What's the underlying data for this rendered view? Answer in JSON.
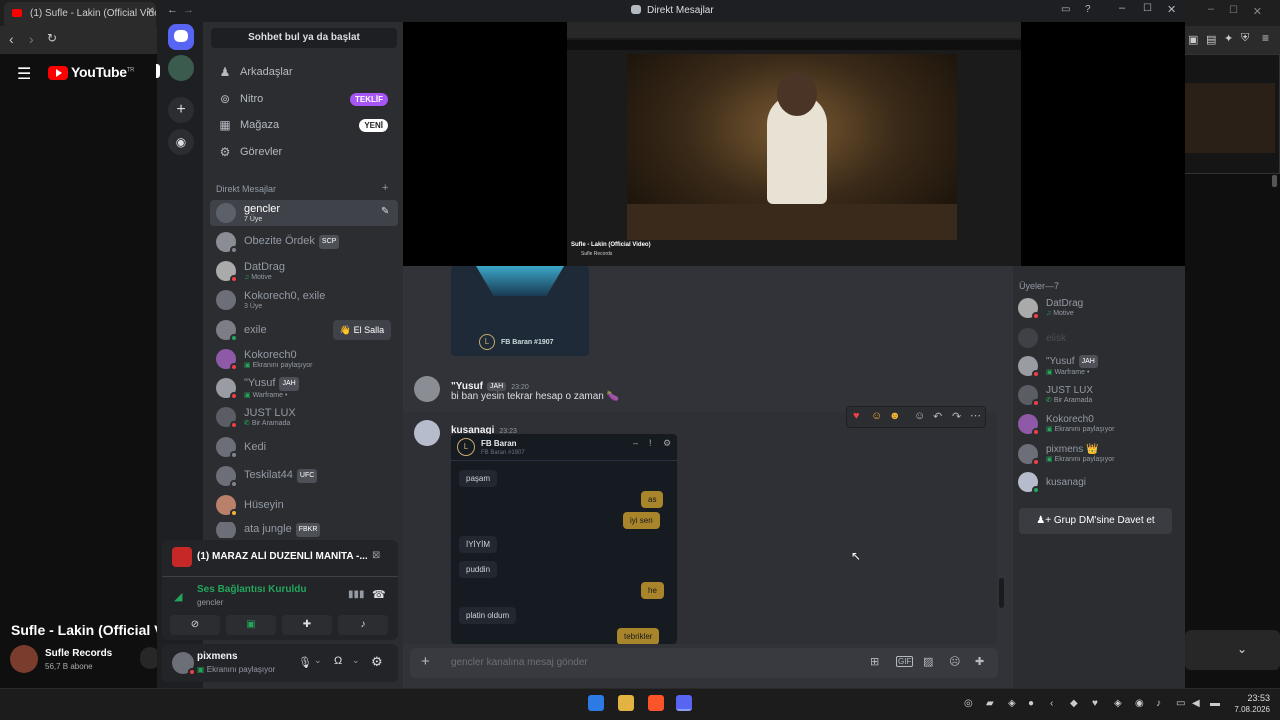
{
  "browser": {
    "tab_title": "(1) Sufle - Lakin (Official Vide",
    "youtube_logo": "YouTube",
    "youtube_region": "TR",
    "video_title": "Sufle - Lakin (Official Video)",
    "channel_name": "Sufle Records",
    "channel_subs": "56,7 B abone"
  },
  "window": {
    "title": "Direkt Mesajlar",
    "back_icon": "back-arrow-icon",
    "forward_icon": "forward-arrow-icon"
  },
  "search": {
    "placeholder": "Sohbet bul ya da başlat"
  },
  "nav": [
    {
      "label": "Arkadaşlar",
      "icon": "friends-icon",
      "badge": ""
    },
    {
      "label": "Nitro",
      "icon": "nitro-icon",
      "badge": "TEKLİF"
    },
    {
      "label": "Mağaza",
      "icon": "shop-icon",
      "badge": "YENİ"
    },
    {
      "label": "Görevler",
      "icon": "quests-icon",
      "badge": ""
    }
  ],
  "dm_header": "Direkt Mesajlar",
  "dms": [
    {
      "name": "gencler",
      "sub": "7 Üye",
      "tag": "",
      "active": true,
      "status": "group"
    },
    {
      "name": "Obezite Ördek",
      "sub": "",
      "tag": "SCP",
      "status": "offline"
    },
    {
      "name": "DatDrag",
      "sub": "Motive",
      "tag": "",
      "status": "dnd"
    },
    {
      "name": "Kokorech0, exile",
      "sub": "3 Üye",
      "tag": "",
      "status": "group"
    },
    {
      "name": "exile",
      "sub": "",
      "tag": "",
      "status": "online",
      "wave": "El Salla"
    },
    {
      "name": "Kokorech0",
      "sub": "Ekranını paylaşıyor",
      "tag": "",
      "status": "dnd"
    },
    {
      "name": "\"Yusuf",
      "sub": "Warframe •",
      "tag": "JAH",
      "status": "dnd"
    },
    {
      "name": "JUST LUX",
      "sub": "Bir Aramada",
      "tag": "",
      "status": "dnd"
    },
    {
      "name": "Kedi",
      "sub": "",
      "tag": "",
      "status": "offline"
    },
    {
      "name": "Teskilat44",
      "sub": "",
      "tag": "UFC",
      "status": "offline"
    },
    {
      "name": "Hüseyin",
      "sub": "",
      "tag": "",
      "status": "idle"
    },
    {
      "name": "ata jungle",
      "sub": "",
      "tag": "FBKR",
      "status": "offline"
    }
  ],
  "voice": {
    "stream_title": "(1) MARAZ ALİ DÜZENLİ MANİTA -...",
    "connection": "Ses Bağlantısı Kuruldu",
    "channel": "gencler"
  },
  "user": {
    "name": "pixmens",
    "status": "Ekranını paylaşıyor"
  },
  "stream_preview": {
    "video_title": "Sufle - Lakin (Official Video)",
    "channel": "Sufle Records"
  },
  "messages": {
    "embed_name": "FB Baran #1907",
    "msg1": {
      "author": "\"Yusuf",
      "tag": "JAH",
      "time": "23:20",
      "text": "bi ban yesin tekrar hesap o zaman 🍆"
    },
    "msg2": {
      "author": "kusanagi",
      "time": "23:23"
    },
    "screenshot": {
      "header": "FB Baran",
      "subheader": "FB Baran #1907",
      "bubbles": [
        {
          "side": "left",
          "text": "paşam"
        },
        {
          "side": "right",
          "text": "as"
        },
        {
          "side": "right",
          "text": "iyi sen"
        },
        {
          "side": "left",
          "text": "İYİYİM"
        },
        {
          "side": "left",
          "text": "puddin"
        },
        {
          "side": "right",
          "text": "he"
        },
        {
          "side": "left",
          "text": "platin oldum"
        },
        {
          "side": "right",
          "text": "tebrikler"
        }
      ]
    }
  },
  "composer": {
    "placeholder": "gencler kanalına mesaj gönder"
  },
  "members_header": "Üyeler—7",
  "members": [
    {
      "name": "DatDrag",
      "sub": "Motive",
      "tag": "",
      "status": "dnd"
    },
    {
      "name": "eiisk",
      "sub": "",
      "tag": "",
      "status": "offline",
      "dim": true
    },
    {
      "name": "\"Yusuf",
      "sub": "Warframe •",
      "tag": "JAH",
      "status": "dnd"
    },
    {
      "name": "JUST LUX",
      "sub": "Bir Aramada",
      "tag": "",
      "status": "dnd"
    },
    {
      "name": "Kokorech0",
      "sub": "Ekranını paylaşıyor",
      "tag": "",
      "status": "dnd"
    },
    {
      "name": "pixmens 👑",
      "sub": "Ekranını paylaşıyor",
      "tag": "",
      "status": "dnd"
    },
    {
      "name": "kusanagi",
      "sub": "",
      "tag": "",
      "status": "online"
    }
  ],
  "invite_button": "Grup DM'sine Davet et",
  "clock": {
    "time": "23:53",
    "date": "7.08.2026"
  },
  "colors": {
    "accent": "#5865f2",
    "online": "#23a55a",
    "dnd": "#f23f43",
    "idle": "#f0b232",
    "nitro": "#a855f7"
  }
}
